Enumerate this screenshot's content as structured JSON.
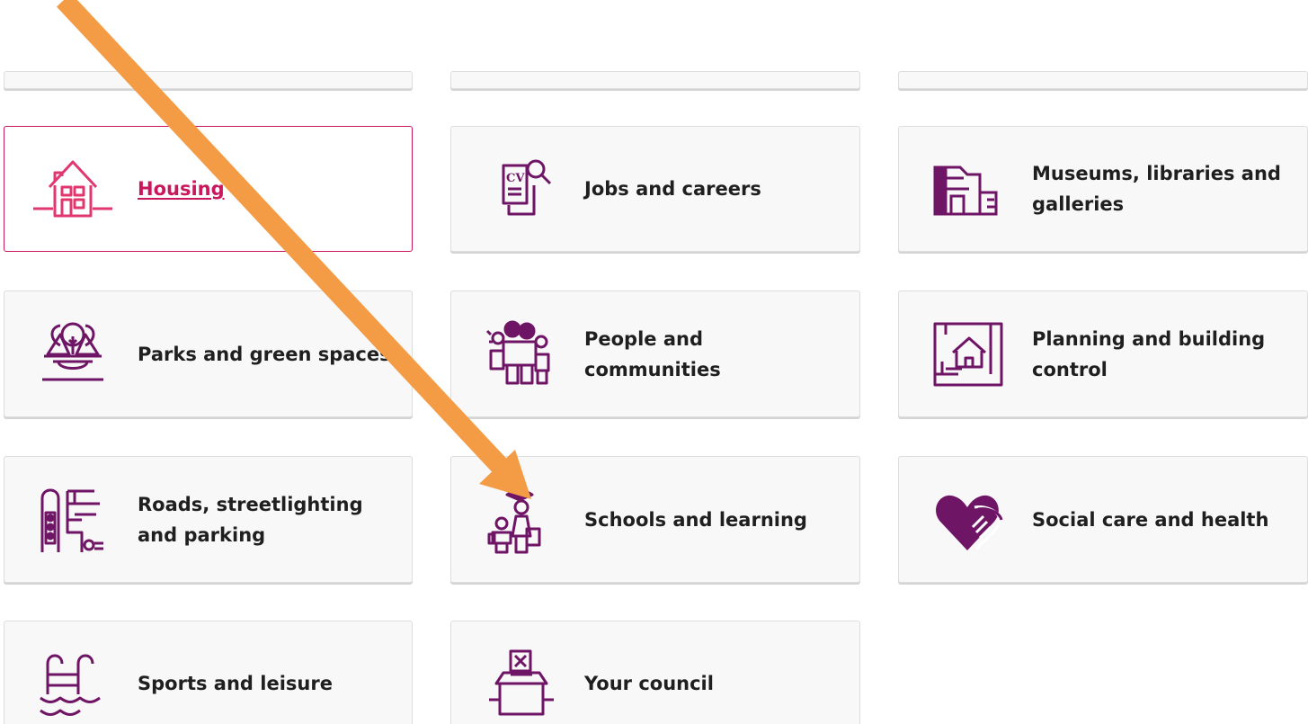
{
  "colors": {
    "brand_purple": "#6f1566",
    "active_pink": "#c8175d",
    "housing_icon": "#e0376f",
    "arrow": "#f39c45",
    "card_bg": "#f8f8f8",
    "text": "#1f1f1f"
  },
  "arrow": {
    "icon": "annotation-arrow",
    "color": "#f39c45"
  },
  "services": [
    {
      "label": "Housing",
      "icon": "house-icon",
      "state": "hovered"
    },
    {
      "label": "Jobs and careers",
      "icon": "cv-search-icon"
    },
    {
      "label": "Museums, libraries and galleries",
      "icon": "museum-building-icon"
    },
    {
      "label": "Parks and green spaces",
      "icon": "park-trees-icon"
    },
    {
      "label": "People and communities",
      "icon": "people-group-icon"
    },
    {
      "label": "Planning and building control",
      "icon": "house-plan-icon"
    },
    {
      "label": "Roads, streetlighting and parking",
      "icon": "traffic-light-road-icon"
    },
    {
      "label": "Schools and learning",
      "icon": "students-graduate-icon"
    },
    {
      "label": "Social care and health",
      "icon": "heart-hand-icon"
    },
    {
      "label": "Sports and leisure",
      "icon": "swimming-pool-icon"
    },
    {
      "label": "Your council",
      "icon": "ballot-box-icon"
    }
  ]
}
